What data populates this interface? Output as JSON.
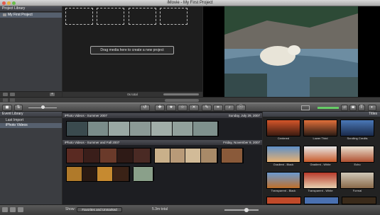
{
  "window": {
    "title": "iMovie - My First Project"
  },
  "project_library": {
    "header": "Project Library",
    "projects": [
      "My First Project"
    ]
  },
  "project_area": {
    "drag_hint": "Drag media here to create a new project",
    "status": "0s total"
  },
  "event_library": {
    "header": "Event Library",
    "items": [
      "Last Import",
      "iPhoto Videos"
    ],
    "selected": "iPhoto Videos"
  },
  "events": [
    {
      "name": "iPhoto Videos - Summer 2007",
      "date": "Sunday, July 29, 2007"
    },
    {
      "name": "iPhoto Videos - Summer and Fall 2007",
      "date": "Friday, November 9, 2007"
    }
  ],
  "titles_panel": {
    "header": "Titles",
    "tiles": [
      "Centered",
      "Lower Third",
      "Scrolling Credits",
      "Gradient - Black",
      "Gradient - White",
      "Echo",
      "Transparent - Black",
      "Transparent - White",
      "Formal"
    ]
  },
  "footer": {
    "show_label": "Show:",
    "show_value": "Favorites and Unmarked",
    "total": "5.3m total"
  },
  "colors": {
    "selection": "#56606e",
    "panel": "#3b3d41",
    "background": "#1d1d1d"
  }
}
